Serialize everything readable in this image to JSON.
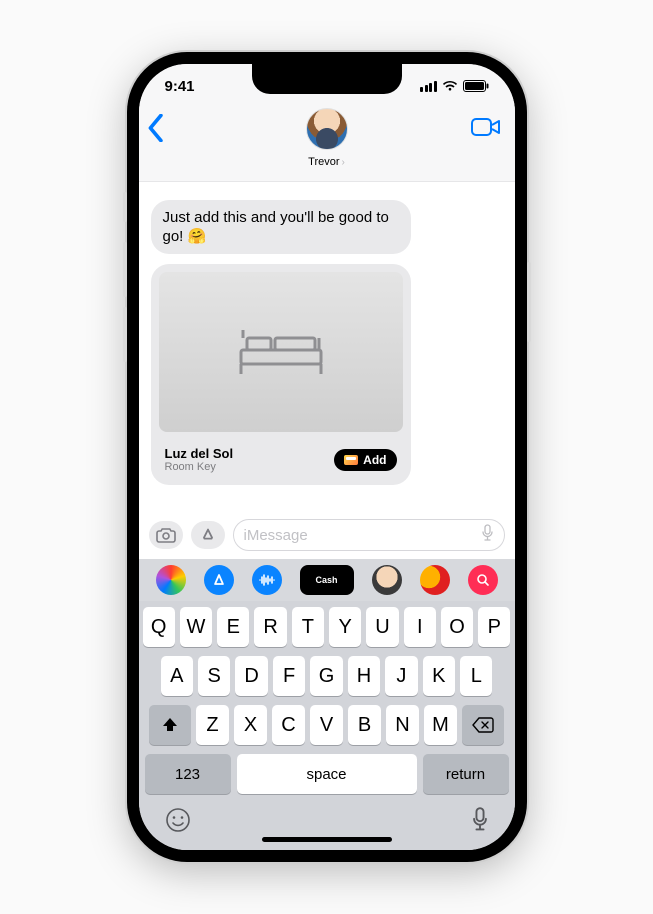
{
  "status": {
    "time": "9:41"
  },
  "nav": {
    "contact_name": "Trevor"
  },
  "messages": {
    "bubble_text": "Just add this and you'll be good to go! ",
    "bubble_emoji": "🤗"
  },
  "attachment": {
    "title": "Luz del Sol",
    "subtitle": "Room Key",
    "add_label": "Add"
  },
  "input": {
    "placeholder": "iMessage"
  },
  "app_strip": {
    "icons": [
      "photos",
      "app-store",
      "music",
      "apple-cash",
      "memoji",
      "animoji",
      "search"
    ]
  },
  "keyboard": {
    "row1": [
      "Q",
      "W",
      "E",
      "R",
      "T",
      "Y",
      "U",
      "I",
      "O",
      "P"
    ],
    "row2": [
      "A",
      "S",
      "D",
      "F",
      "G",
      "H",
      "J",
      "K",
      "L"
    ],
    "row3": [
      "Z",
      "X",
      "C",
      "V",
      "B",
      "N",
      "M"
    ],
    "numbers_label": "123",
    "space_label": "space",
    "return_label": "return"
  }
}
